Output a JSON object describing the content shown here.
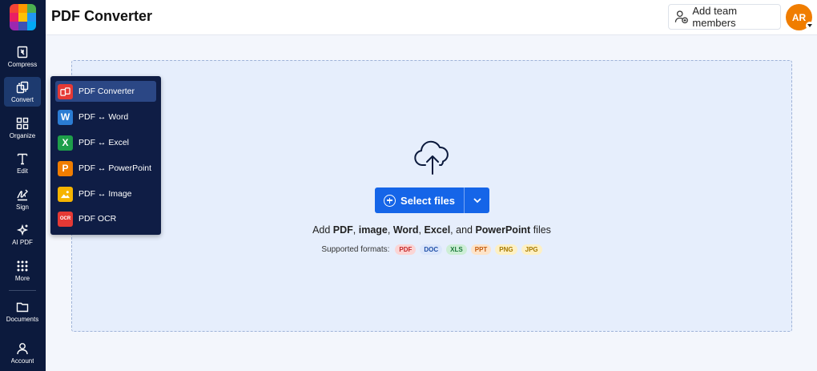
{
  "app": {
    "title": "PDF Converter",
    "logo_colors": [
      "#f44336",
      "#ff9800",
      "#4caf50",
      "#e91e63",
      "#ffc107",
      "#2196f3",
      "#9c27b0",
      "#3f51b5",
      "#03a9f4"
    ]
  },
  "sidebar": {
    "items": [
      {
        "label": "Compress",
        "icon": "compress-icon"
      },
      {
        "label": "Convert",
        "icon": "convert-icon",
        "active": true
      },
      {
        "label": "Organize",
        "icon": "grid-icon"
      },
      {
        "label": "Edit",
        "icon": "text-edit-icon"
      },
      {
        "label": "Sign",
        "icon": "signature-icon"
      },
      {
        "label": "AI PDF",
        "icon": "sparkle-icon"
      },
      {
        "label": "More",
        "icon": "dots-grid-icon"
      },
      {
        "label": "Documents",
        "icon": "folder-icon"
      },
      {
        "label": "Account",
        "icon": "user-icon"
      }
    ]
  },
  "header": {
    "add_team_label": "Add team members",
    "avatar_initials": "AR",
    "avatar_color": "#f07d00"
  },
  "convert_menu": {
    "items": [
      {
        "label": "PDF Converter",
        "icon": "pdf-converter-icon",
        "color": "#e53935",
        "glyph": "",
        "active": true
      },
      {
        "label": "PDF ↔ Word",
        "icon": "word-icon",
        "color": "#2b7cd3",
        "glyph": "W"
      },
      {
        "label": "PDF ↔ Excel",
        "icon": "excel-icon",
        "color": "#1e9e4a",
        "glyph": "X"
      },
      {
        "label": "PDF ↔ PowerPoint",
        "icon": "powerpoint-icon",
        "color": "#f07d00",
        "glyph": "P"
      },
      {
        "label": "PDF ↔ Image",
        "icon": "image-icon",
        "color": "#f6b400",
        "glyph": ""
      },
      {
        "label": "PDF OCR",
        "icon": "ocr-icon",
        "color": "#e53935",
        "glyph": "OCR"
      }
    ]
  },
  "dropzone": {
    "select_label": "Select files",
    "add_text_prefix": "Add ",
    "types": [
      "PDF",
      "image",
      "Word",
      "Excel",
      "PowerPoint"
    ],
    "add_text_suffix": " files",
    "formats_label": "Supported formats:",
    "formats": [
      {
        "label": "PDF",
        "bg": "#fbd5d5",
        "fg": "#c62828"
      },
      {
        "label": "DOC",
        "bg": "#dbe6fb",
        "fg": "#1e4fa8"
      },
      {
        "label": "XLS",
        "bg": "#cdeed6",
        "fg": "#1b7a3a"
      },
      {
        "label": "PPT",
        "bg": "#fde3c8",
        "fg": "#c4590a"
      },
      {
        "label": "PNG",
        "bg": "#fdf0c4",
        "fg": "#a87900"
      },
      {
        "label": "JPG",
        "bg": "#fdf0c4",
        "fg": "#a87900"
      }
    ]
  }
}
